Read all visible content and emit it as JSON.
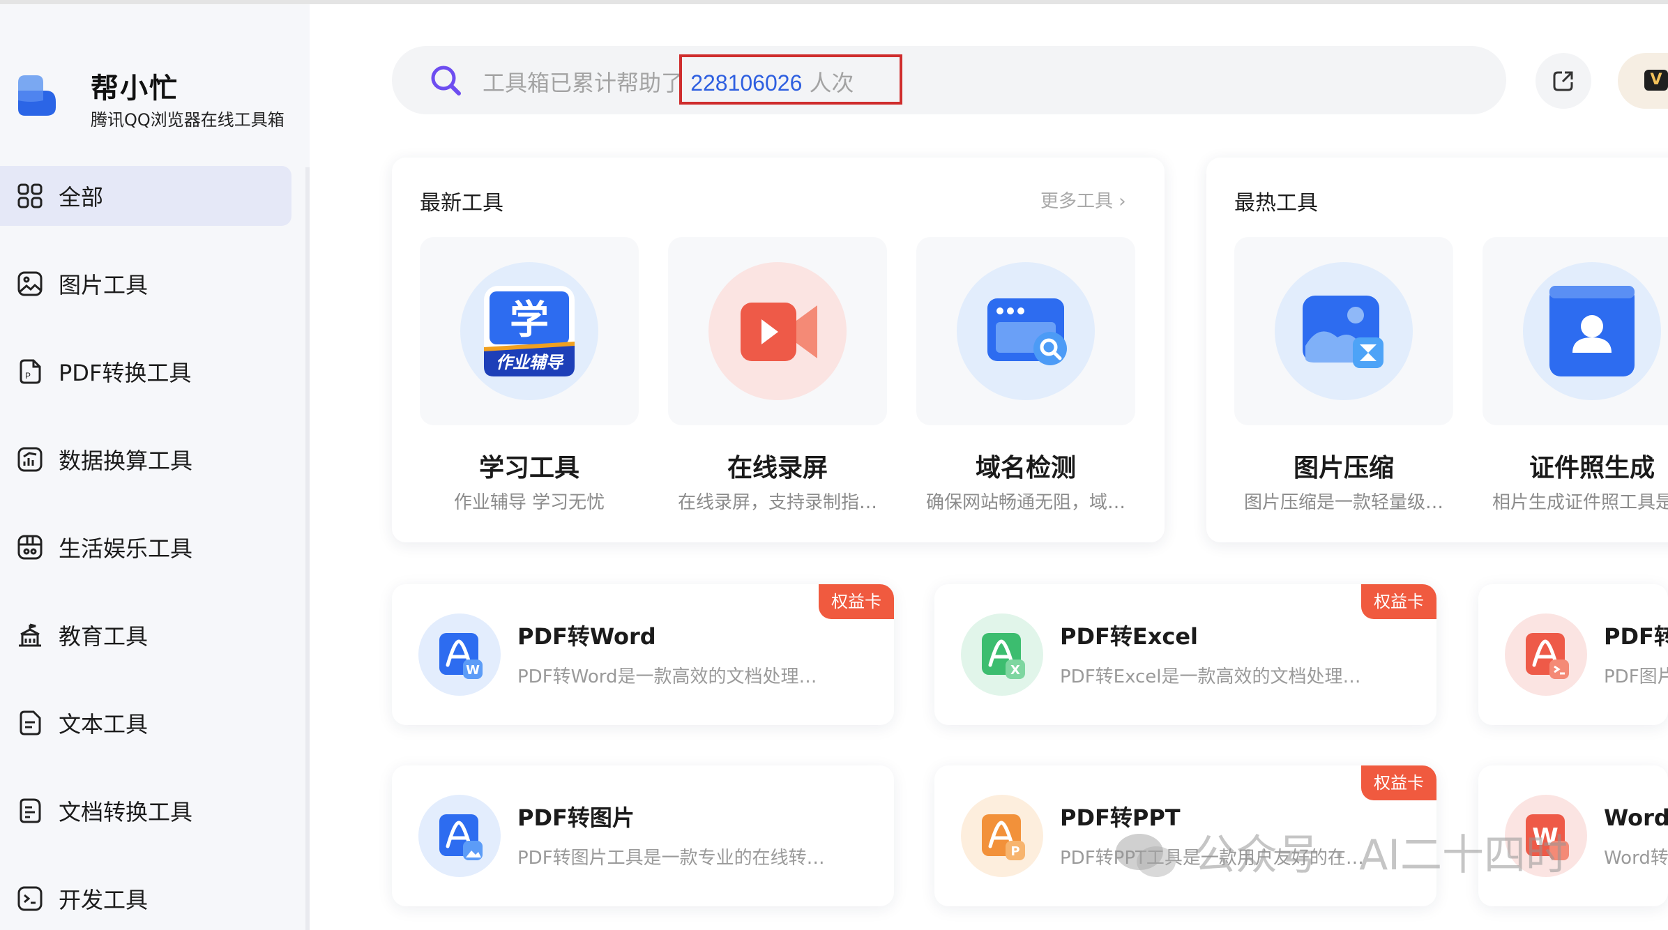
{
  "brand": {
    "title": "帮小忙",
    "subtitle": "腾讯QQ浏览器在线工具箱"
  },
  "sidebar": {
    "items": [
      {
        "label": "全部",
        "icon": "grid-icon",
        "active": true
      },
      {
        "label": "图片工具",
        "icon": "image-icon"
      },
      {
        "label": "PDF转换工具",
        "icon": "pdf-icon"
      },
      {
        "label": "数据换算工具",
        "icon": "chart-icon"
      },
      {
        "label": "生活娱乐工具",
        "icon": "calendar-icon"
      },
      {
        "label": "教育工具",
        "icon": "school-icon"
      },
      {
        "label": "文本工具",
        "icon": "text-file-icon"
      },
      {
        "label": "文档转换工具",
        "icon": "document-convert-icon"
      },
      {
        "label": "开发工具",
        "icon": "terminal-icon"
      }
    ]
  },
  "search": {
    "prefix": "工具箱已累计帮助了",
    "count": "228106026",
    "suffix": "人次"
  },
  "newest": {
    "title": "最新工具",
    "more": "更多工具",
    "tools": [
      {
        "name": "学习工具",
        "desc": "作业辅导 学习无忧",
        "icon": "study-icon",
        "icon_text": "学",
        "ribbon_text": "作业辅导"
      },
      {
        "name": "在线录屏",
        "desc": "在线录屏，支持录制指…",
        "icon": "video-camera-icon"
      },
      {
        "name": "域名检测",
        "desc": "确保网站畅通无阻，域…",
        "icon": "browser-search-icon"
      }
    ]
  },
  "hottest": {
    "title": "最热工具",
    "tools": [
      {
        "name": "图片压缩",
        "desc": "图片压缩是一款轻量级…",
        "icon": "image-compress-icon"
      },
      {
        "name": "证件照生成",
        "desc": "相片生成证件照工具是…",
        "icon": "id-photo-icon"
      }
    ]
  },
  "cards": [
    {
      "title": "PDF转Word",
      "desc": "PDF转Word是一款高效的文档处理…",
      "badge": "权益卡",
      "icon": "pdf-word-icon",
      "letter": "W"
    },
    {
      "title": "PDF转Excel",
      "desc": "PDF转Excel是一款高效的文档处理…",
      "badge": "权益卡",
      "icon": "pdf-excel-icon",
      "letter": "X"
    },
    {
      "title": "PDF转",
      "desc": "PDF图片",
      "badge": "",
      "icon": "pdf-image-icon",
      "letter": ""
    },
    {
      "title": "PDF转图片",
      "desc": "PDF转图片工具是一款专业的在线转…",
      "badge": "",
      "icon": "pdf-picture-icon",
      "letter": ""
    },
    {
      "title": "PDF转PPT",
      "desc": "PDF转PPT工具是一款用户友好的在…",
      "badge": "权益卡",
      "icon": "pdf-ppt-icon",
      "letter": "P"
    },
    {
      "title": "Word转",
      "desc": "Word转",
      "badge": "",
      "icon": "word-convert-icon",
      "letter": "W"
    }
  ],
  "watermark": {
    "text": "公众号 · AI二十四时"
  },
  "vip": {
    "letter": "V"
  },
  "colors": {
    "accent": "#2e5fe0",
    "active_nav": "#e5e8f7",
    "badge": "#f05a3f",
    "highlight_border": "#cf2d2d"
  }
}
